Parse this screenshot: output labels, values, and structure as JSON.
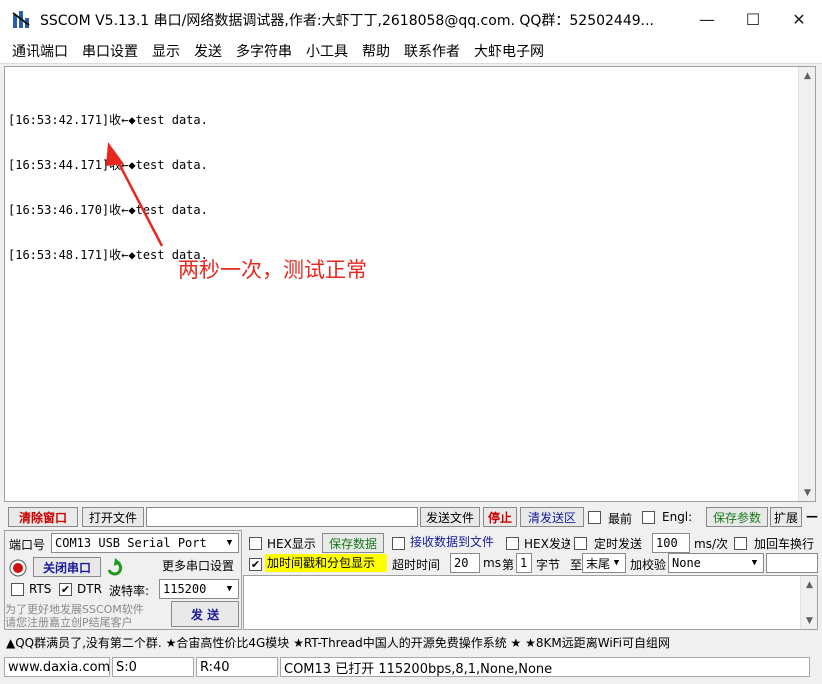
{
  "window": {
    "title": "SSCOM V5.13.1 串口/网络数据调试器,作者:大虾丁丁,2618058@qq.com. QQ群：52502449...",
    "minimize": "—",
    "maximize": "☐",
    "close": "✕"
  },
  "menu": [
    "通讯端口",
    "串口设置",
    "显示",
    "发送",
    "多字符串",
    "小工具",
    "帮助",
    "联系作者",
    "大虾电子网"
  ],
  "receive": {
    "lines": [
      "[16:53:42.171]收←◆test data.",
      "[16:53:44.171]收←◆test data.",
      "[16:53:46.170]收←◆test data.",
      "[16:53:48.171]收←◆test data."
    ]
  },
  "annotation": {
    "text": "两秒一次，测试正常",
    "color": "#e8281e"
  },
  "toolbar": {
    "clear_window": "清除窗口",
    "open_file": "打开文件",
    "file_path": "",
    "send_file": "发送文件",
    "stop": "停止",
    "clear_send": "清发送区",
    "last": "最前",
    "english": "Engl:",
    "save_params": "保存参数",
    "expand": "扩展",
    "dash": "—"
  },
  "port": {
    "port_label": "端口号",
    "port_value": "COM13 USB Serial Port",
    "more_settings": "更多串口设置",
    "close_port": "关闭串口",
    "rts": "RTS",
    "dtr": "DTR",
    "baud_label": "波特率:",
    "baud_value": "115200"
  },
  "options": {
    "hex_display": "HEX显示",
    "save_data": "保存数据",
    "recv_to_file": "接收数据到文件",
    "hex_send": "HEX发送",
    "timed_send": "定时发送",
    "interval": "100",
    "interval_unit": "ms/次",
    "add_crlf": "加回车换行",
    "timestamp": "加时间戳和分包显示",
    "timeout_label": "超时时间",
    "timeout_value": "20",
    "timeout_unit": "ms",
    "nth": "第",
    "byte_index": "1",
    "byte_label": "字节",
    "to": "至",
    "end_value": "末尾",
    "checksum_label": "加校验",
    "checksum_value": "None"
  },
  "promo": {
    "line1": "为了更好地发展SSCOM软件",
    "line2": "请您注册嘉立创P结尾客户",
    "send": "发  送"
  },
  "ticker": "▲QQ群满员了,没有第二个群.   ★合宙高性价比4G模块    ★RT-Thread中国人的开源免费操作系统    ★  ★8KM远距离WiFi可自组网",
  "status": {
    "site": "www.daxia.com",
    "sent": "S:0",
    "received": "R:40",
    "port_info": "COM13 已打开  115200bps,8,1,None,None"
  }
}
